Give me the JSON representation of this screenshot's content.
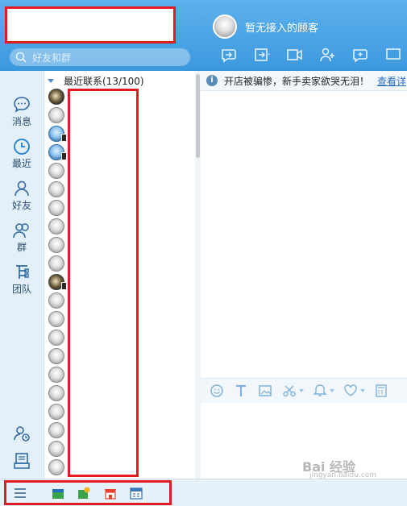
{
  "header": {
    "search_placeholder": "好友和群",
    "visitor_name": "暂无接入的顾客"
  },
  "toolbar_icons": [
    "transfer-chat-icon",
    "forward-icon",
    "video-icon",
    "add-contact-icon",
    "add-chat-icon",
    "more-icon"
  ],
  "sidebar": {
    "items": [
      {
        "label": "消息",
        "icon": "message-icon"
      },
      {
        "label": "最近",
        "icon": "clock-icon",
        "active": true
      },
      {
        "label": "好友",
        "icon": "person-icon"
      },
      {
        "label": "群",
        "icon": "group-icon"
      },
      {
        "label": "团队",
        "icon": "team-icon"
      }
    ],
    "bottom_icons": [
      "user-clock-icon",
      "inbox-icon",
      "menu-icon"
    ]
  },
  "contacts": {
    "group_title": "最近联系(13/100)",
    "avatars": [
      "photo",
      "gray",
      "online",
      "online",
      "gray",
      "gray",
      "gray",
      "gray",
      "gray",
      "gray",
      "photo",
      "gray",
      "gray",
      "gray",
      "gray",
      "gray",
      "gray",
      "gray",
      "gray",
      "gray",
      "gray"
    ]
  },
  "notice": {
    "text": "开店被骗惨，新手卖家欲哭无泪！",
    "link": "查看详"
  },
  "input_toolbar_icons": [
    "emoji-icon",
    "font-icon",
    "image-icon",
    "scissors-icon",
    "bell-icon",
    "heart-icon",
    "calculator-icon"
  ],
  "watermark": {
    "text": "Bai 经验",
    "sub": "jingyan.baidu.com"
  },
  "colors": {
    "header_blue": "#3c98de",
    "redaction": "#e21b22",
    "link": "#2a6fc0"
  }
}
